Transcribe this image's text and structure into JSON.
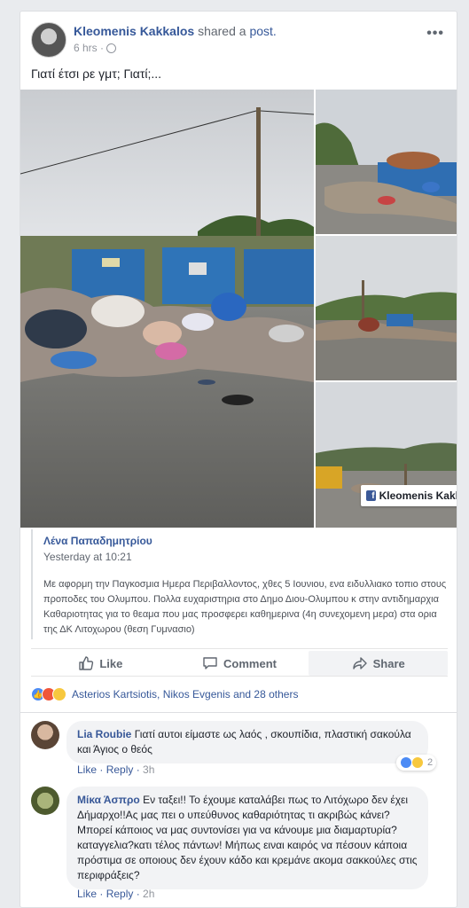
{
  "post": {
    "author": "Kleomenis Kakkalos",
    "action": "shared a",
    "link": "post.",
    "time": "6 hrs ·",
    "text": "Γιατί έτσι ρε γμτ; Γιατί;..."
  },
  "photo_tag": {
    "label": "Kleomenis Kakka"
  },
  "shared_post": {
    "author": "Λένα Παπαδημητρίου",
    "time": "Yesterday at 10:21",
    "text": "Με αφορμη την Παγκοσμια Ημερα Περιβαλλοντος, χθες 5 Ιουνιου, ενα ειδυλλιακο τοπιο στους προποδες του Ολυμπου. Πολλα ευχαριστηρια στο Δημο Διου-Ολυμπου κ στην αντιδημαρχια Καθαριοτητας για το θεαμα που μας προσφερει καθημερινα (4η συνεχομενη μερα) στα ορια της ΔΚ Λιτοχωρου (θεση Γυμνασιο)"
  },
  "actions": {
    "like": "Like",
    "comment": "Comment",
    "share": "Share"
  },
  "reactions": {
    "summary": "Asterios Kartsiotis, Nikos Evgenis and 28 others"
  },
  "comments": [
    {
      "author": "Lia Roubie",
      "text": "Γιατί αυτοι είμαστε ως λαός , σκουπίδια, πλαστική σακούλα και Άγιος ο θεός",
      "like": "Like",
      "reply": "Reply",
      "time": "3h",
      "reaction_count": "2"
    },
    {
      "author": "Μίκα Άσπρο",
      "text": "Εν ταξει!! Το έχουμε καταλάβει πως το Λιτόχωρο δεν έχει Δήμαρχο!!Ας μας πει ο υπεύθυνος καθαριότητας τι ακριβώς κάνει? Μπορεί κάποιος να μας συντονίσει για να κάνουμε μια διαμαρτυρία?καταγγελια?κατι τέλος πάντων! Μήπως ειναι καιρός να πέσουν κάποια πρόστιμα σε οποιους δεν έχουν κάδο και κρεμάνε ακομα σακκούλες στις περιφράξεις?",
      "like": "Like",
      "reply": "Reply",
      "time": "2h"
    }
  ],
  "colors": {
    "link": "#365899",
    "like_reaction": "#4c8bf5",
    "angry_reaction": "#f0553a",
    "sad_reaction": "#f7c83e"
  },
  "icons": {
    "more": "more-options-icon",
    "privacy": "globe-icon",
    "like": "thumbs-up-icon",
    "comment": "comment-bubble-icon",
    "share": "share-arrow-icon",
    "fb": "facebook-icon"
  }
}
